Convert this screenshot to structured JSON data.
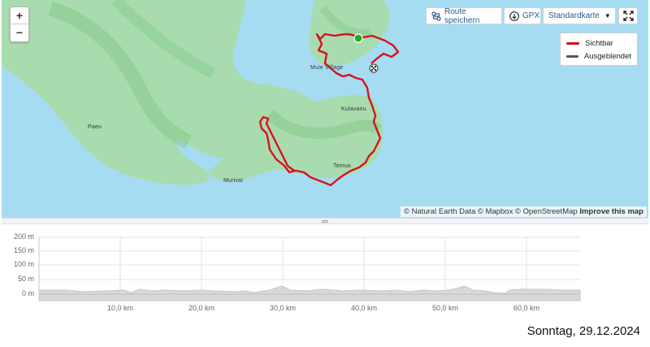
{
  "map": {
    "zoom_in": "+",
    "zoom_out": "−",
    "places": [
      "Paeu",
      "Muie Village",
      "Kulavanu",
      "Temuo",
      "Murivai"
    ],
    "buttons": {
      "save_route": "Route speichern",
      "gpx": "GPX",
      "map_style": "Standardkarte"
    },
    "legend": {
      "visible": "Sichtbar",
      "hidden": "Ausgeblendet",
      "visible_color": "#d6121e",
      "hidden_color": "#555555"
    },
    "attribution": {
      "text": "© Natural Earth Data © Mapbox © OpenStreetMap",
      "improve": "Improve this map"
    },
    "colors": {
      "water": "#a6dcf2",
      "land": "#a8dcae",
      "route": "#d6121e",
      "start": "#27a727"
    }
  },
  "elevation": {
    "y_ticks": [
      "200 m",
      "150 m",
      "100 m",
      "50 m",
      "0 m"
    ],
    "x_ticks": [
      "10,0 km",
      "20,0 km",
      "30,0 km",
      "40,0 km",
      "50,0 km",
      "60,0 km"
    ]
  },
  "date": "Sonntag, 29.12.2024"
}
